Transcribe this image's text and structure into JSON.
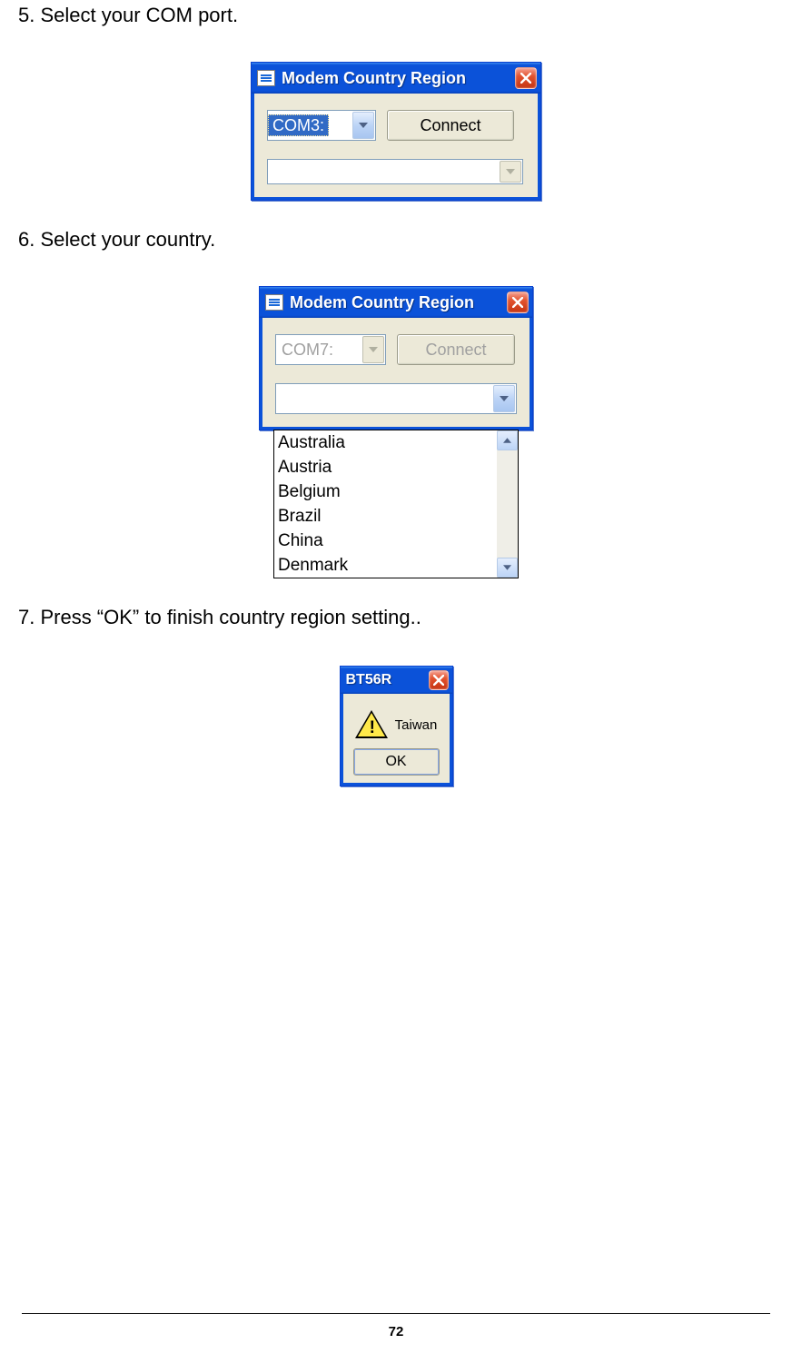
{
  "steps": {
    "s5": "5.  Select your COM port.",
    "s6": "6.  Select your country.",
    "s7": "7.  Press “OK” to finish country region setting.."
  },
  "dialog1": {
    "title": "Modem Country Region",
    "port_value": "COM3:",
    "connect_label": "Connect",
    "country_value": ""
  },
  "dialog2": {
    "title": "Modem Country Region",
    "port_value": "COM7:",
    "connect_label": "Connect",
    "country_value": "",
    "country_list": [
      "Australia",
      "Austria",
      "Belgium",
      "Brazil",
      "China",
      "Denmark"
    ]
  },
  "dialog3": {
    "title": "BT56R",
    "message": "Taiwan",
    "ok_label": "OK"
  },
  "page_number": "72"
}
